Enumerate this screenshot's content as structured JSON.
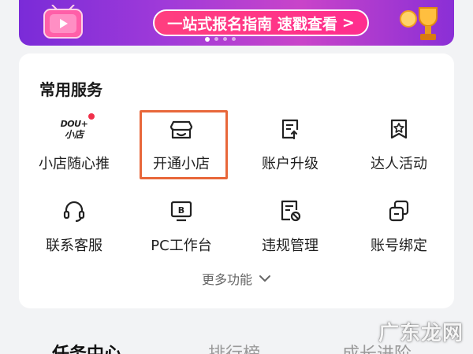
{
  "banner": {
    "pill_text": "一站式报名指南 速戳查看",
    "pill_arrow": ">",
    "colors": {
      "from": "#7a2bd8",
      "to": "#c944c9",
      "pill": "#ff2d8e"
    }
  },
  "services": {
    "title": "常用服务",
    "items": [
      {
        "label": "小店随心推",
        "icon": "dou-plus-logo",
        "logo_top": "DOU+",
        "logo_bottom": "小店"
      },
      {
        "label": "开通小店",
        "icon": "shop-icon",
        "highlighted": true
      },
      {
        "label": "账户升级",
        "icon": "upgrade-icon"
      },
      {
        "label": "达人活动",
        "icon": "star-bookmark-icon"
      },
      {
        "label": "联系客服",
        "icon": "headset-icon"
      },
      {
        "label": "PC工作台",
        "icon": "monitor-b-icon"
      },
      {
        "label": "违规管理",
        "icon": "violation-doc-icon"
      },
      {
        "label": "账号绑定",
        "icon": "link-squares-icon"
      }
    ],
    "more_label": "更多功能",
    "highlight_color": "#e8673a"
  },
  "tabs": [
    {
      "label": "任务中心",
      "active": true
    },
    {
      "label": "排行榜",
      "active": false
    },
    {
      "label": "成长进阶",
      "active": false
    }
  ],
  "watermark": "广东龙网"
}
